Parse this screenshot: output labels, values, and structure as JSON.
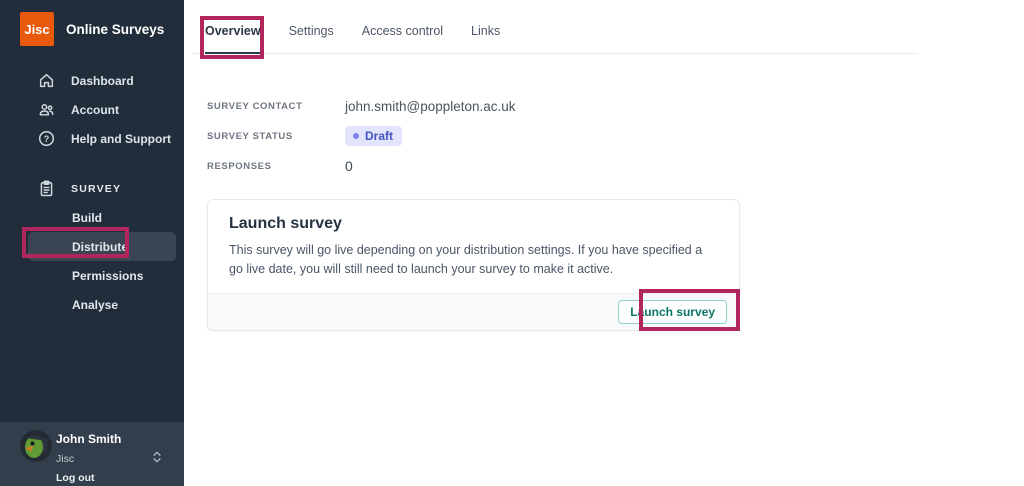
{
  "app": {
    "logo": "Jisc",
    "title": "Online Surveys"
  },
  "colors": {
    "sidebar_bg": "#222d3b",
    "sidebar_active_bg": "#3a4453",
    "user_panel_bg": "#323e4c",
    "logo_orange": "#e8590c",
    "annotation_pink": "#b1265c",
    "badge_bg": "#e1e4fb",
    "badge_text": "#4553c0",
    "button_teal": "#0e7569"
  },
  "sidebar": {
    "nav": [
      {
        "label": "Dashboard",
        "icon": "home-icon"
      },
      {
        "label": "Account",
        "icon": "users-icon"
      },
      {
        "label": "Help and Support",
        "icon": "help-icon"
      }
    ],
    "survey_section": {
      "label": "SURVEY",
      "icon": "clipboard-icon",
      "items": [
        {
          "label": "Build",
          "active": false
        },
        {
          "label": "Distribute",
          "active": true
        },
        {
          "label": "Permissions",
          "active": false
        },
        {
          "label": "Analyse",
          "active": false
        }
      ]
    },
    "user": {
      "name": "John Smith",
      "org": "Jisc",
      "logout": "Log out"
    }
  },
  "tabs": [
    {
      "label": "Overview",
      "active": true
    },
    {
      "label": "Settings",
      "active": false
    },
    {
      "label": "Access control",
      "active": false
    },
    {
      "label": "Links",
      "active": false
    }
  ],
  "overview": {
    "fields": [
      {
        "label": "SURVEY CONTACT",
        "value": "john.smith@poppleton.ac.uk"
      },
      {
        "label": "SURVEY STATUS",
        "value": "Draft"
      },
      {
        "label": "RESPONSES",
        "value": "0"
      }
    ],
    "launch_card": {
      "title": "Launch survey",
      "description": "This survey will go live depending on your distribution settings. If you have specified a go live date, you will still need to launch your survey to make it active.",
      "button_label": "Launch survey"
    }
  },
  "annotations": {
    "color": "#b1265c",
    "targets": [
      "overview-tab",
      "distribute-nav-item",
      "launch-survey-button"
    ]
  }
}
